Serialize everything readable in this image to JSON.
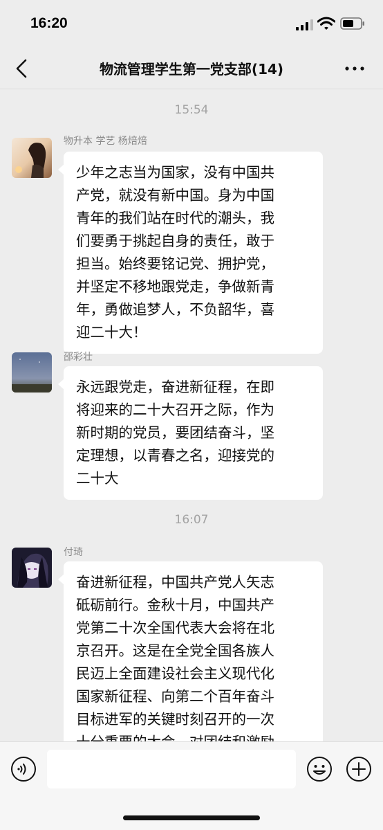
{
  "status_bar": {
    "time": "16:20"
  },
  "nav": {
    "title": "物流管理学生第一党支部(14)"
  },
  "messages": [
    {
      "type": "timestamp",
      "text": "15:54"
    },
    {
      "type": "message",
      "sender": "物升本 学艺 杨焙焙",
      "text": "少年之志当为国家，没有中国共\n产党，就没有新中国。身为中国\n青年的我们站在时代的潮头，我\n们要勇于挑起自身的责任，敢于\n担当。始终要铭记党、拥护党，\n并坚定不移地跟党走，争做新青\n年，勇做追梦人，不负韶华，喜\n迎二十大！"
    },
    {
      "type": "message",
      "sender": "邵彩壮",
      "text": "永远跟党走，奋进新征程，在即\n将迎来的二十大召开之际，作为\n新时期的党员，要团结奋斗，坚\n定理想，以青春之名，迎接党的\n二十大"
    },
    {
      "type": "timestamp",
      "text": "16:07"
    },
    {
      "type": "message",
      "sender": "付琦",
      "text": "奋进新征程，中国共产党人矢志\n砥砺前行。金秋十月，中国共产\n党第二十次全国代表大会将在北\n京召开。这是在全党全国各族人\n民迈上全面建设社会主义现代化\n国家新征程、向第二个百年奋斗\n目标进军的关键时刻召开的一次\n十分重要的大会，对团结和激励\n全国各族人民为夺取中国特色社"
    }
  ],
  "input": {
    "placeholder": ""
  },
  "icons": {
    "back": "chevron-left-icon",
    "more": "more-dots-icon",
    "voice": "voice-icon",
    "emoji": "emoji-icon",
    "plus": "plus-icon"
  }
}
